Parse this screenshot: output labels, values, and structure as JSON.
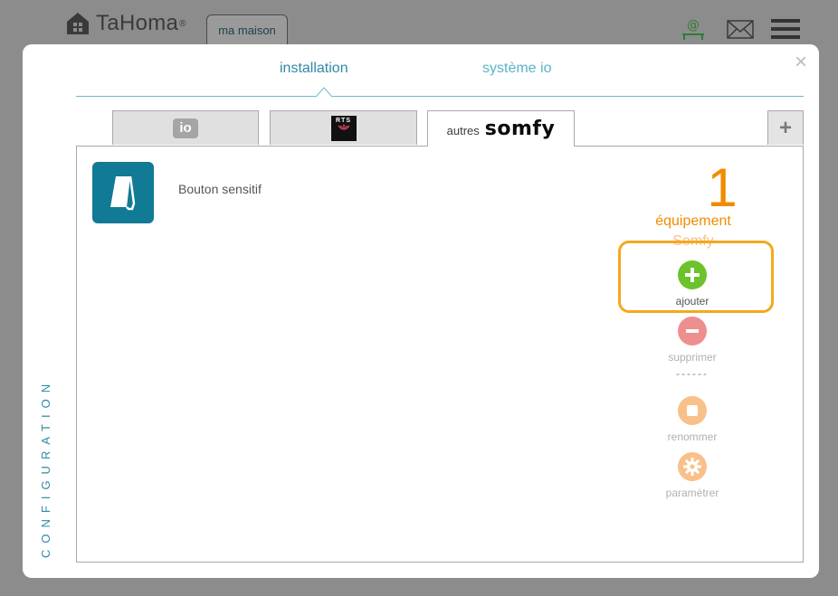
{
  "header": {
    "app_name": "TaHoma",
    "reg_mark": "®",
    "house_tab": "ma maison"
  },
  "modal": {
    "close_symbol": "×",
    "tabs": [
      "installation",
      "système io"
    ],
    "active_tab": "installation",
    "protocol_tabs": {
      "io_label": "io",
      "rts_label": "RTS",
      "somfy_prefix": "autres",
      "somfy_brand": "somfy",
      "add_symbol": "+"
    },
    "devices": [
      {
        "name": "Bouton sensitif",
        "icon": "sensitive-button-icon"
      }
    ],
    "summary": {
      "count": "1",
      "label": "équipement",
      "sublabel": "Somfy"
    },
    "actions": {
      "add": "ajouter",
      "delete": "supprimer",
      "separator": "------",
      "rename": "renommer",
      "settings": "paramétrer"
    },
    "side_label": "CONFIGURATION"
  },
  "colors": {
    "accent": "#2f8aa6",
    "orange": "#f08c00",
    "highlight": "#f5a81e",
    "add": "#6bc22b",
    "delete": "#ef8e8e",
    "device_tile": "#117a94"
  }
}
